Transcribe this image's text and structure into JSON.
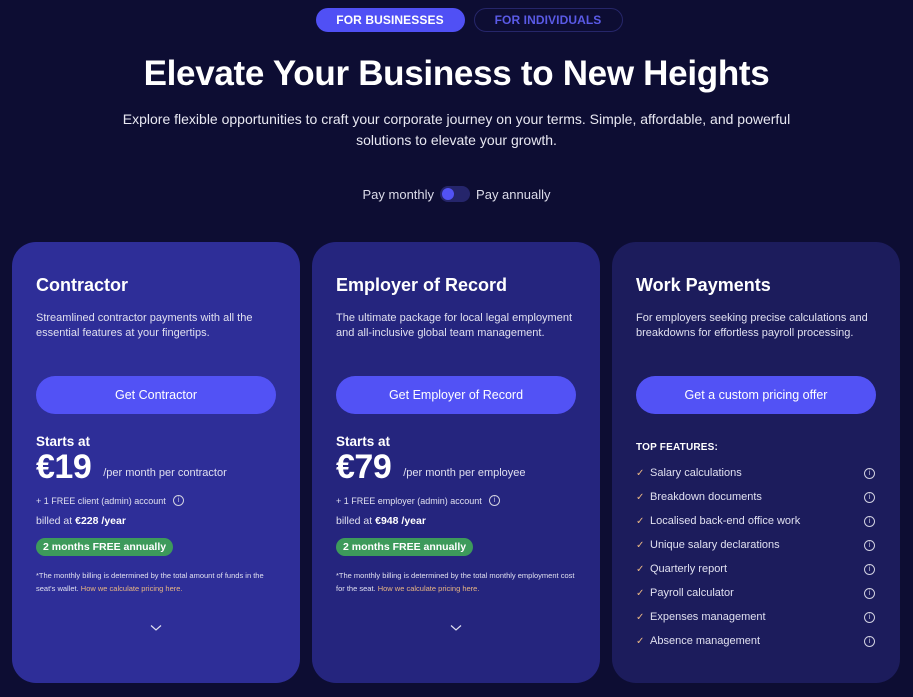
{
  "audience_tabs": [
    {
      "label": "FOR BUSINESSES",
      "active": true
    },
    {
      "label": "FOR INDIVIDUALS",
      "active": false
    }
  ],
  "hero": {
    "title": "Elevate Your Business to New Heights",
    "subtitle": "Explore flexible opportunities to craft your corporate journey on your terms. Simple, affordable, and powerful solutions to elevate your growth."
  },
  "billing": {
    "monthly_label": "Pay monthly",
    "annual_label": "Pay annually",
    "annual_selected": false
  },
  "colors": {
    "background": "#0d0d33",
    "accent": "#5252f5",
    "badge_green": "#3d9a5b",
    "link_orange": "#e8b583",
    "check_orange": "#e8b583"
  },
  "plans": [
    {
      "title": "Contractor",
      "description": "Streamlined contractor payments with all the essential features at your fingertips.",
      "cta": "Get Contractor",
      "starts_at": "Starts at",
      "price": "€19",
      "per": "/per month per contractor",
      "free_account": "+ 1 FREE client (admin) account",
      "billed_prefix": "billed at",
      "billed_value": "€228 /year",
      "badge": "2 months FREE annually",
      "footnote": "*The monthly billing is determined by the total amount of funds in the seat's wallet.",
      "footnote_link": "How we calculate pricing here."
    },
    {
      "title": "Employer of Record",
      "description": "The ultimate package for local legal employment and all-inclusive global team management.",
      "cta": "Get Employer of Record",
      "starts_at": "Starts at",
      "price": "€79",
      "per": "/per month per employee",
      "free_account": "+ 1 FREE employer (admin) account",
      "billed_prefix": "billed at",
      "billed_value": "€948 /year",
      "badge": "2 months FREE annually",
      "footnote": "*The monthly billing is determined by the total monthly employment cost for the seat.",
      "footnote_link": "How we calculate pricing here."
    },
    {
      "title": "Work Payments",
      "description": "For employers seeking precise calculations and breakdowns for effortless payroll processing.",
      "cta": "Get a custom pricing offer",
      "features_title": "TOP FEATURES:",
      "features": [
        "Salary calculations",
        "Breakdown documents",
        "Localised back-end office work",
        "Unique salary declarations",
        "Quarterly report",
        "Payroll calculator",
        "Expenses management",
        "Absence management"
      ]
    }
  ]
}
